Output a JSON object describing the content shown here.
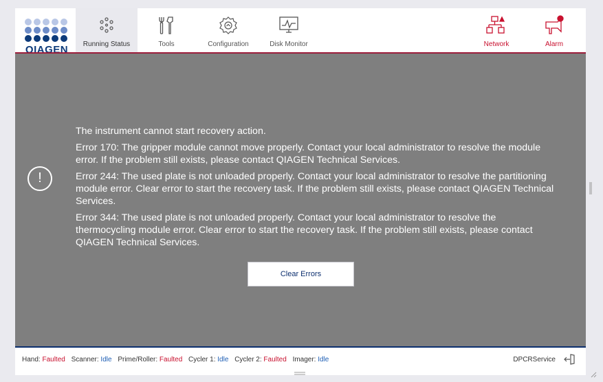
{
  "nav": {
    "logo_text": "QIAGEN",
    "items": [
      {
        "label": "Running Status"
      },
      {
        "label": "Tools"
      },
      {
        "label": "Configuration"
      },
      {
        "label": "Disk Monitor"
      },
      {
        "label": "Network"
      },
      {
        "label": "Alarm"
      }
    ]
  },
  "dialog": {
    "lines": [
      "The instrument cannot start recovery action.",
      "Error 170: The gripper module cannot move properly. Contact your local administrator to resolve the module error. If the problem still exists, please contact QIAGEN Technical Services.",
      "Error 244: The used plate is not unloaded properly. Contact your local administrator to resolve the partitioning module error. Clear error to start the recovery task. If the problem still exists, please contact QIAGEN Technical Services.",
      "Error 344: The used plate is not unloaded properly. Contact your local administrator to resolve the thermocycling module error. Clear error to start the recovery task. If the problem still exists, please contact QIAGEN Technical Services."
    ],
    "button_label": "Clear Errors"
  },
  "status": {
    "items": [
      {
        "label": "Hand:",
        "value": "Faulted"
      },
      {
        "label": "Scanner:",
        "value": "Idle"
      },
      {
        "label": "Prime/Roller:",
        "value": "Faulted"
      },
      {
        "label": "Cycler 1:",
        "value": "Idle"
      },
      {
        "label": "Cycler 2:",
        "value": "Faulted"
      },
      {
        "label": "Imager:",
        "value": "Idle"
      }
    ],
    "user": "DPCRService"
  },
  "colors": {
    "brand_blue": "#0d3b7a",
    "accent_red": "#c8102e",
    "idle_blue": "#1f5fb5",
    "content_gray": "#7f7f7f"
  },
  "icons": [
    "qiagen-logo",
    "running-status-icon",
    "tools-icon",
    "configuration-icon",
    "disk-monitor-icon",
    "network-icon",
    "alarm-icon",
    "alert-icon",
    "logout-icon"
  ]
}
